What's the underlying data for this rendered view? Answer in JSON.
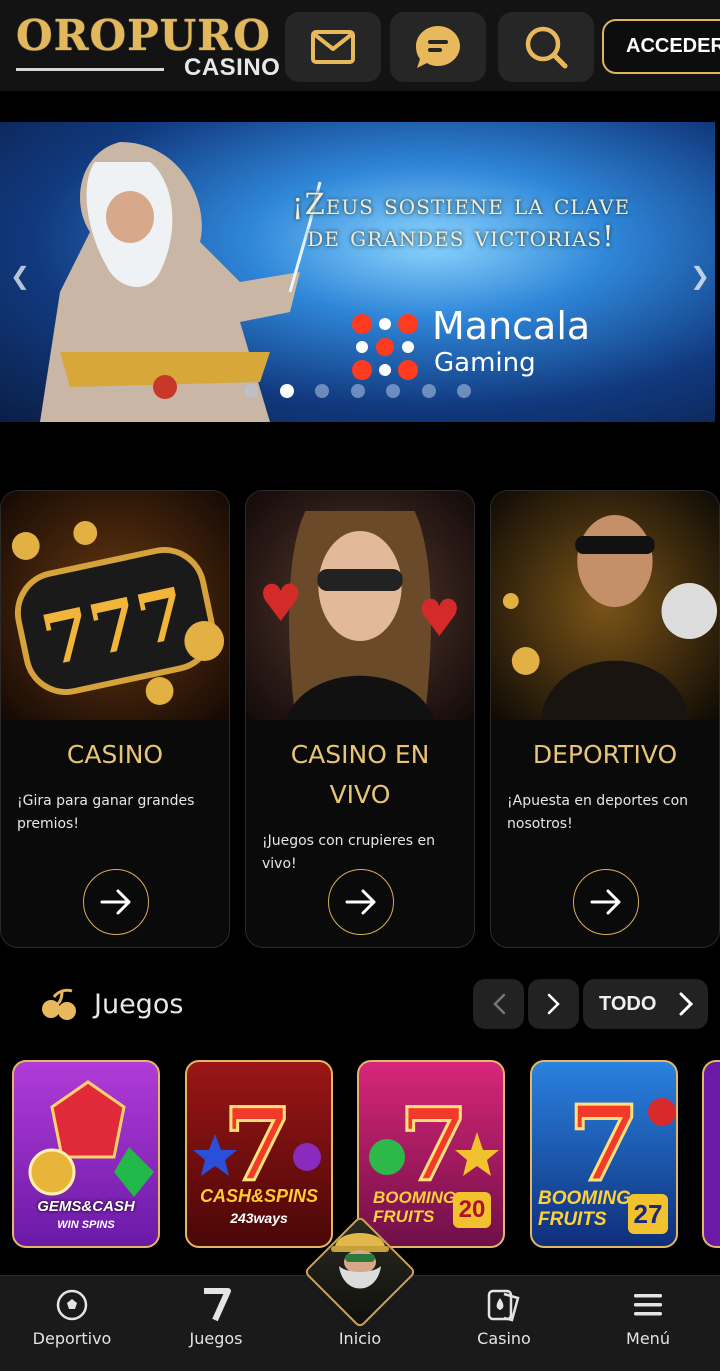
{
  "header": {
    "logo_main": "OROPURO",
    "logo_sub": "CASINO",
    "login_label": "ACCEDER",
    "icons": [
      "mail-icon",
      "chat-icon",
      "search-icon"
    ]
  },
  "banner": {
    "title_line1": "¡Zeus sostiene la clave",
    "title_line2": "de grandes victorias!",
    "brand_name": "Mancala",
    "brand_sub": "Gaming",
    "slide_count": 7,
    "active_slide": 2
  },
  "categories": [
    {
      "title": "CASINO",
      "desc": "¡Gira para ganar grandes premios!"
    },
    {
      "title": "CASINO EN VIVO",
      "desc": "¡Juegos con crupieres en vivo!"
    },
    {
      "title": "DEPORTIVO",
      "desc": "¡Apuesta en deportes con nosotros!"
    }
  ],
  "games": {
    "title": "Juegos",
    "all_label": "TODO",
    "tiles": [
      {
        "name": "GEMS&CASH",
        "sub": "WIN SPINS"
      },
      {
        "name": "CASH&SPINS",
        "sub": "243ways"
      },
      {
        "name": "BOOMING FRUITS",
        "sub": "20"
      },
      {
        "name": "BOOMING FRUITS",
        "sub": "27"
      }
    ]
  },
  "bottom_nav": [
    {
      "label": "Deportivo",
      "icon": "soccer-ball-icon"
    },
    {
      "label": "Juegos",
      "icon": "seven-icon"
    },
    {
      "label": "Inicio",
      "icon": "home-mascot-icon"
    },
    {
      "label": "Casino",
      "icon": "cards-icon"
    },
    {
      "label": "Menú",
      "icon": "menu-icon"
    }
  ],
  "colors": {
    "gold": "#e2b45e",
    "header_bg": "#131313",
    "page_bg": "#000000"
  }
}
